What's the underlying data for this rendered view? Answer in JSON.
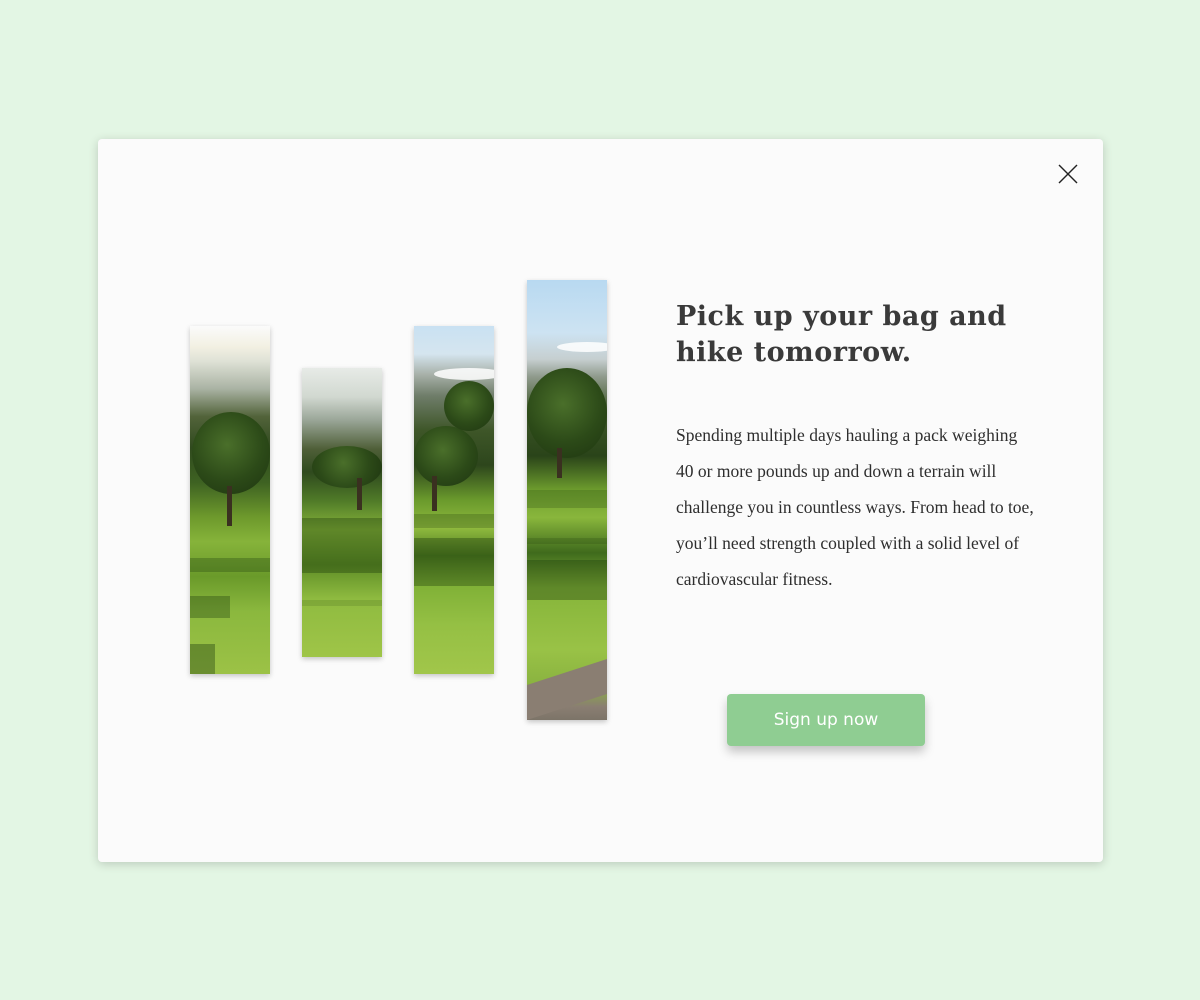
{
  "modal": {
    "headline": "Pick up your bag and hike tomorrow.",
    "body": "Spending multiple days hauling a pack weighing 40 or more pounds up and down a terrain will challenge you in countless ways. From head to toe, you’ll need strength coupled with a solid level of cardiovascular fitness.",
    "cta_label": "Sign up now",
    "close_icon": "close-icon"
  },
  "colors": {
    "page_background": "#e3f6e4",
    "modal_background": "#fbfbfb",
    "button_background": "#8fcd92",
    "button_text": "#ffffff",
    "heading_text": "#3a3a3a",
    "body_text": "#2e2e2e"
  },
  "gallery": {
    "image_subject": "golf-course-landscape",
    "strip_count": 4
  }
}
